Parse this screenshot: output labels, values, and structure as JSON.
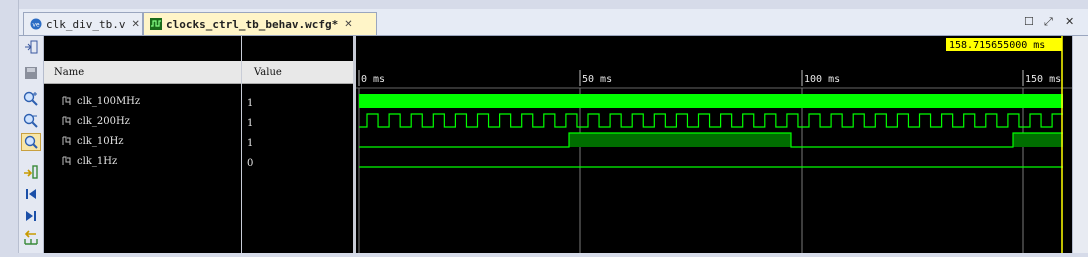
{
  "tabs": [
    {
      "label": "clk_div_tb.v",
      "icon": "verilog-file-icon",
      "active": false
    },
    {
      "label": "clocks_ctrl_tb_behav.wcfg*",
      "icon": "waveform-icon",
      "active": true
    }
  ],
  "window_controls": {
    "restore": "☐",
    "maximize": "⤢",
    "close": "✕"
  },
  "columns": {
    "name": "Name",
    "value": "Value"
  },
  "signals": [
    {
      "name": "clk_100MHz",
      "value": "1"
    },
    {
      "name": "clk_200Hz",
      "value": "1"
    },
    {
      "name": "clk_10Hz",
      "value": "1"
    },
    {
      "name": "clk_1Hz",
      "value": "0"
    }
  ],
  "cursor_time": "158.715655000 ms",
  "time_ticks": [
    "0 ms",
    "50 ms",
    "100 ms",
    "150 ms"
  ],
  "toolbar_icons": [
    "zoom-fit-icon",
    "save-icon",
    "zoom-in-icon",
    "zoom-out-icon",
    "zoom-full-icon",
    "goto-cursor-icon",
    "goto-start-icon",
    "goto-end-icon",
    "add-marker-icon"
  ],
  "colors": {
    "wave": "#00ff00",
    "wave_dim": "#00a000",
    "cursor": "#ffff00",
    "grid": "#8a8a8a"
  }
}
